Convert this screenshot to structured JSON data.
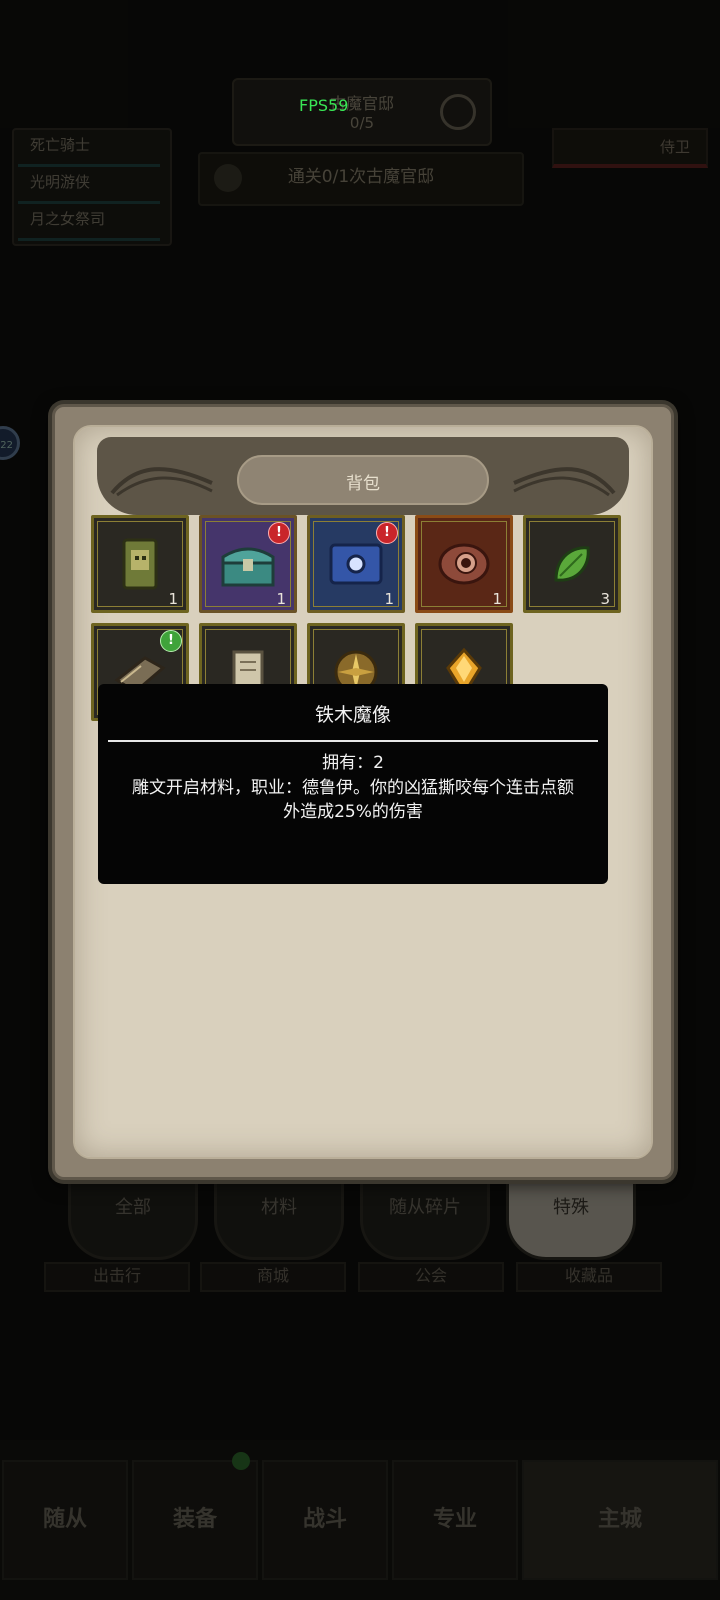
{
  "hud": {
    "fps": "FPS59",
    "quest_title": "古魔官邸",
    "quest_progress": "0/5",
    "pass_text": "通关0/1次古魔官邸",
    "guard_label": "侍卫",
    "roles": [
      "死亡骑士",
      "光明游侠",
      "月之女祭司"
    ],
    "avatar_badge": "22"
  },
  "dialog": {
    "title": "背包",
    "slots": [
      {
        "name": "statue-item",
        "count": "1",
        "frame": "normal",
        "badge": ""
      },
      {
        "name": "teal-chest-item",
        "count": "1",
        "frame": "purple",
        "badge": "!"
      },
      {
        "name": "blue-chest-item",
        "count": "1",
        "frame": "blue",
        "badge": "!"
      },
      {
        "name": "red-eye-item",
        "count": "1",
        "frame": "orange",
        "badge": ""
      },
      {
        "name": "green-leaf-item",
        "count": "3",
        "frame": "normal",
        "badge": ""
      },
      {
        "name": "book-item",
        "count": "",
        "frame": "normal",
        "badge": "!"
      },
      {
        "name": "scroll-item",
        "count": "",
        "frame": "normal",
        "badge": ""
      },
      {
        "name": "compass-item",
        "count": "",
        "frame": "normal",
        "badge": ""
      },
      {
        "name": "amber-gem-item",
        "count": "",
        "frame": "normal",
        "badge": ""
      }
    ]
  },
  "tooltip": {
    "title": "铁木魔像",
    "owned": "拥有：2",
    "description": "雕文开启材料，职业：德鲁伊。你的凶猛撕咬每个连击点额外造成25%的伤害"
  },
  "tabs": {
    "items": [
      "全部",
      "材料",
      "随从碎片",
      "特殊"
    ],
    "active": "特殊",
    "captions": [
      "出击行",
      "商城",
      "公会",
      "收藏品"
    ]
  },
  "bottom_nav": [
    "随从",
    "装备",
    "战斗",
    "专业",
    "主城"
  ],
  "colors": {
    "fps": "#39e655",
    "tooltip_bg": "#050505",
    "red_badge": "#c9252a",
    "green_badge": "#3fa33a"
  }
}
